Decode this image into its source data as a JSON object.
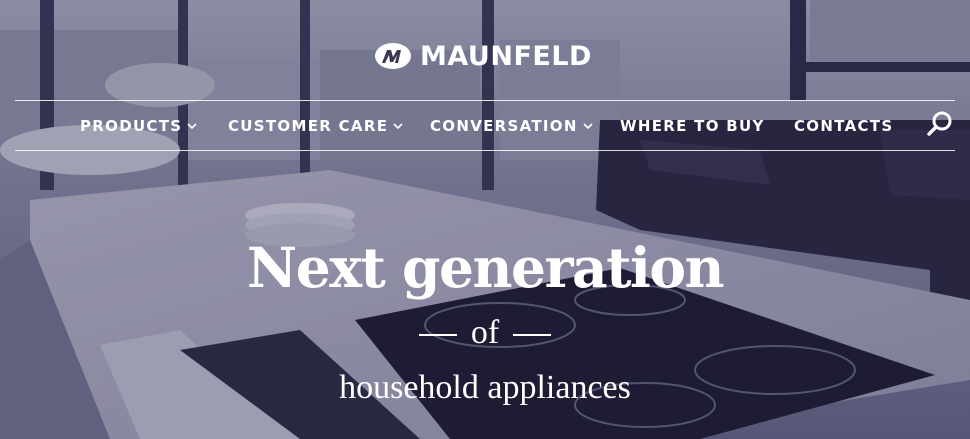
{
  "brand": {
    "name": "MAUNFELD"
  },
  "nav": {
    "items": [
      {
        "label": "PRODUCTS",
        "has_dropdown": true
      },
      {
        "label": "CUSTOMER CARE",
        "has_dropdown": true
      },
      {
        "label": "CONVERSATION",
        "has_dropdown": true
      },
      {
        "label": "WHERE TO BUY",
        "has_dropdown": false
      },
      {
        "label": "CONTACTS",
        "has_dropdown": false
      }
    ],
    "search_icon": "search-icon"
  },
  "hero": {
    "headline": "Next generation",
    "connector": "of",
    "subheadline": "household appliances"
  },
  "colors": {
    "overlay": "#222048",
    "text": "#ffffff"
  }
}
